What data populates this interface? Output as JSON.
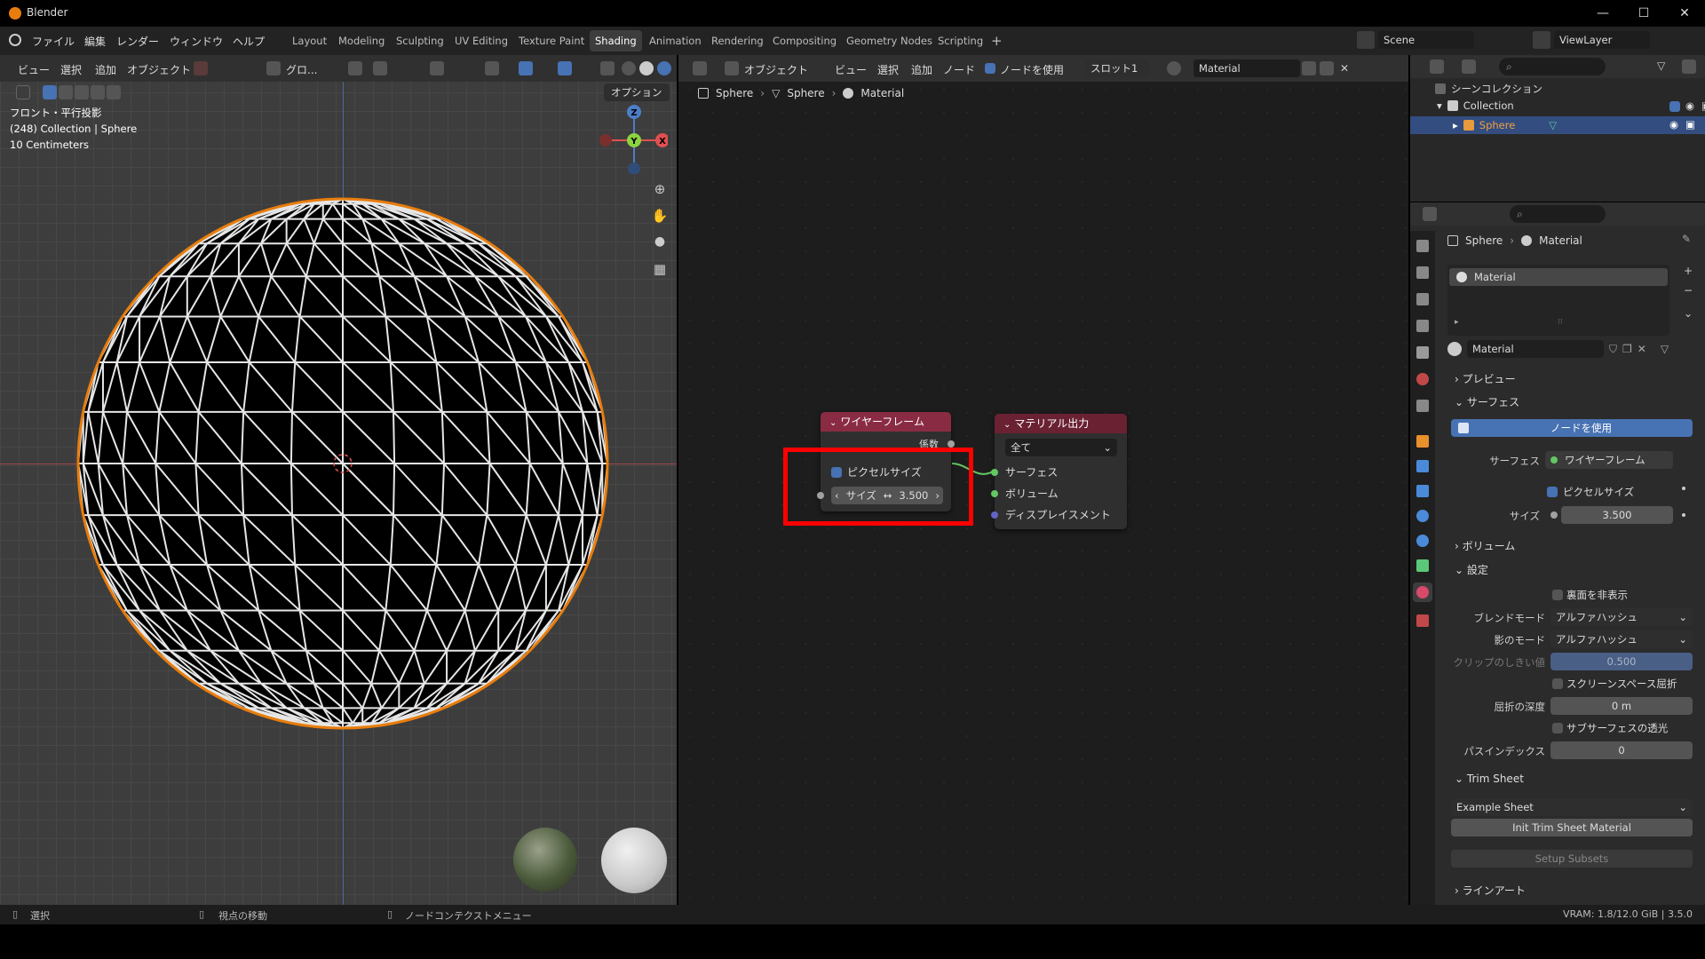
{
  "window": {
    "title": "Blender"
  },
  "menu": [
    "ファイル",
    "編集",
    "レンダー",
    "ウィンドウ",
    "ヘルプ"
  ],
  "workspaces": [
    "Layout",
    "Modeling",
    "Sculpting",
    "UV Editing",
    "Texture Paint",
    "Shading",
    "Animation",
    "Rendering",
    "Compositing",
    "Geometry Nodes",
    "Scripting"
  ],
  "active_workspace": "Shading",
  "scene": "Scene",
  "view_layer": "ViewLayer",
  "viewport": {
    "menus": [
      "ビュー",
      "選択",
      "追加",
      "オブジェクト"
    ],
    "transform": "グロ...",
    "options": "オプション",
    "overlay_lines": [
      "フロント・平行投影",
      "(248) Collection | Sphere",
      "10 Centimeters"
    ],
    "gizmo": {
      "z": "Z",
      "y": "Y",
      "x": "X"
    }
  },
  "node_editor": {
    "object_mode": "オブジェクト",
    "menus": [
      "ビュー",
      "選択",
      "追加",
      "ノード"
    ],
    "use_nodes": "ノードを使用",
    "slot": "スロット1",
    "material": "Material",
    "breadcrumb": [
      "Sphere",
      "Sphere",
      "Material"
    ],
    "wireframe_node": {
      "title": "ワイヤーフレーム",
      "output": "係数",
      "pixel_size": "ピクセルサイズ",
      "size_label": "サイズ",
      "size_value": "3.500"
    },
    "output_node": {
      "title": "マテリアル出力",
      "target": "全て",
      "inputs": [
        "サーフェス",
        "ボリューム",
        "ディスプレイスメント"
      ]
    }
  },
  "outliner": {
    "root": "シーンコレクション",
    "collection": "Collection",
    "object": "Sphere"
  },
  "properties": {
    "breadcrumb": [
      "Sphere",
      "Material"
    ],
    "slot_name": "Material",
    "material_name": "Material",
    "preview": "プレビュー",
    "surface": "サーフェス",
    "use_nodes_btn": "ノードを使用",
    "surface_label": "サーフェス",
    "surface_value": "ワイヤーフレーム",
    "pixel_size": "ピクセルサイズ",
    "size_label": "サイズ",
    "size_value": "3.500",
    "volume": "ボリューム",
    "settings": "設定",
    "backface": "裏面を非表示",
    "blend_mode_label": "ブレンドモード",
    "blend_mode": "アルファハッシュ",
    "shadow_mode_label": "影のモード",
    "shadow_mode": "アルファハッシュ",
    "clip_label": "クリップのしきい値",
    "clip_value": "0.500",
    "ssr": "スクリーンスペース屈折",
    "refraction_label": "屈折の深度",
    "refraction_value": "0 m",
    "sss": "サブサーフェスの透光",
    "pass_label": "パスインデックス",
    "pass_value": "0",
    "trim_sheet": "Trim Sheet",
    "example_sheet": "Example Sheet",
    "init_btn": "Init Trim Sheet Material",
    "setup_btn": "Setup Subsets",
    "lineart": "ラインアート"
  },
  "status": {
    "select": "選択",
    "move_view": "視点の移動",
    "node_menu": "ノードコンテクストメニュー",
    "vram": "VRAM: 1.8/12.0 GiB | 3.5.0"
  },
  "colors": {
    "accent_blue": "#4772b3",
    "highlight_red": "#ff0000",
    "node_header_shader": "#8a2b44",
    "node_header_output": "#6a2233",
    "selected_orange": "#e87d0d"
  }
}
